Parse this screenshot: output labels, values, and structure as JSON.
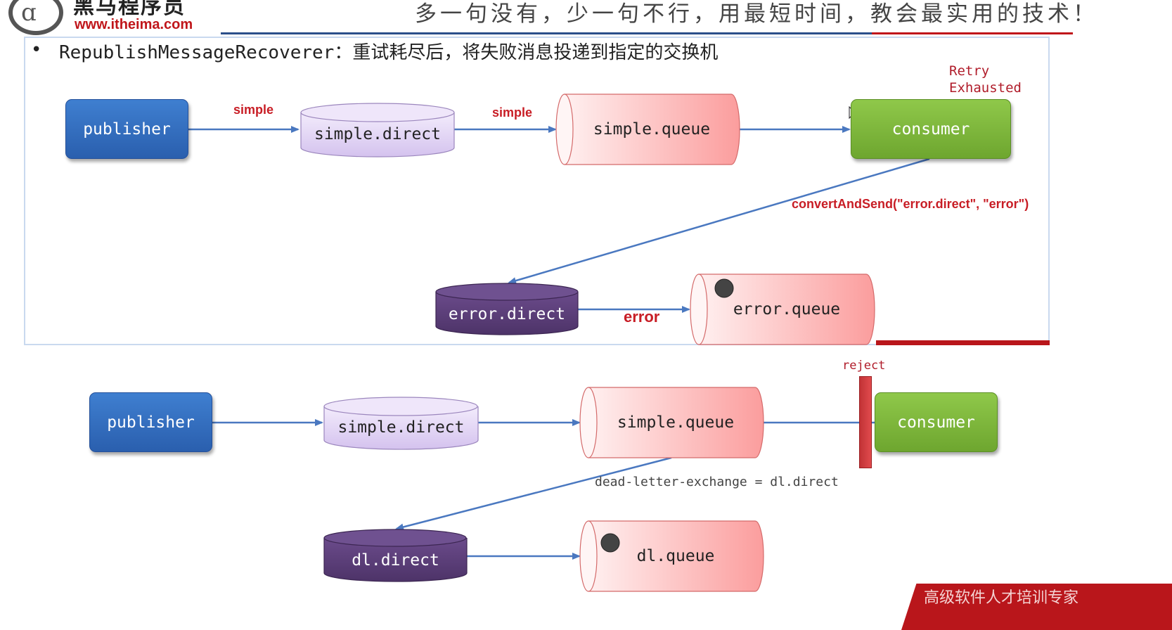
{
  "header": {
    "logo_glyph": "ɑ",
    "brand_name": "黑马程序员",
    "brand_url": "www.itheima.com",
    "slogan": "多一句没有，少一句不行，用最短时间，教会最实用的技术！"
  },
  "bullet": {
    "title": "RepublishMessageRecoverer",
    "desc": "：重试耗尽后，将失败消息投递到指定的交换机"
  },
  "top_diagram": {
    "publisher": "publisher",
    "exchange": "simple.direct",
    "queue": "simple.queue",
    "consumer": "consumer",
    "error_exchange": "error.direct",
    "error_queue": "error.queue",
    "edge_pub_to_exchange": "simple",
    "edge_exchange_to_queue": "simple",
    "edge_error_route": "error",
    "retry_label_1": "Retry",
    "retry_label_2": "Exhausted",
    "convert_label": "convertAndSend(\"error.direct\", \"error\")"
  },
  "bottom_diagram": {
    "publisher": "publisher",
    "exchange": "simple.direct",
    "queue": "simple.queue",
    "consumer": "consumer",
    "reject_label": "reject",
    "dl_config_label": "dead-letter-exchange = dl.direct",
    "dl_exchange": "dl.direct",
    "dl_queue": "dl.queue"
  },
  "footer": {
    "corner_text": "高级软件人才培训专家"
  },
  "colors": {
    "publisher": "#2f68bd",
    "consumer": "#7cb63b",
    "exchange_fill": "#e2d6f5",
    "queue_fill": "#fdbcbc",
    "dark_exchange": "#5b3e78",
    "arrow": "#4a78c0",
    "red_text": "#c81d25"
  }
}
